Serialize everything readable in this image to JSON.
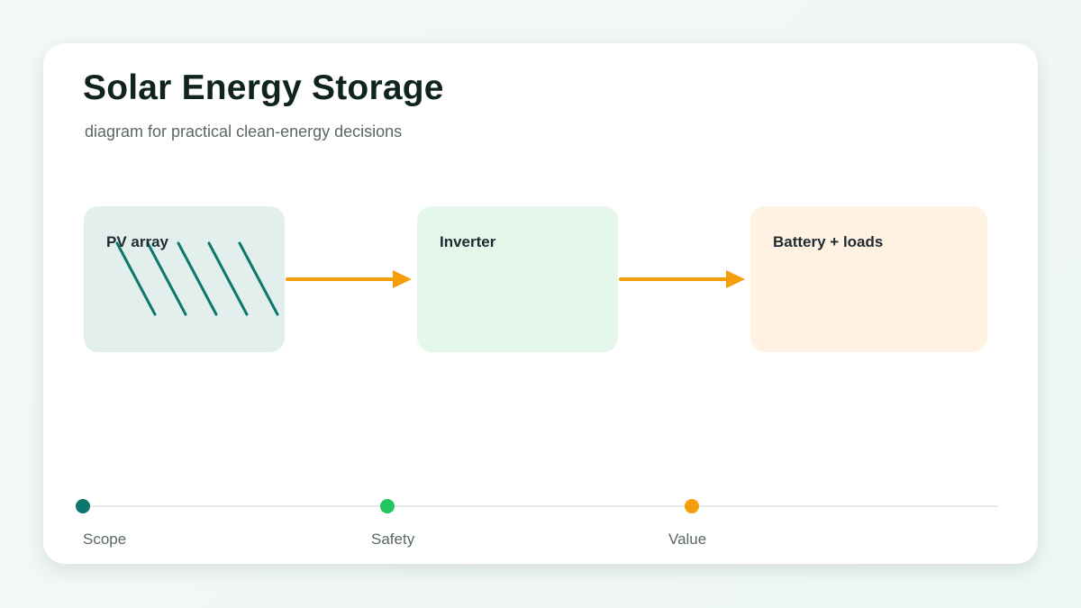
{
  "title": "Solar Energy Storage",
  "subtitle": "diagram for practical clean-energy decisions",
  "nodes": [
    {
      "id": "pv",
      "label": "PV array",
      "fill": "#e2efec"
    },
    {
      "id": "inverter",
      "label": "Inverter",
      "fill": "#e5f6ea"
    },
    {
      "id": "battery",
      "label": "Battery + loads",
      "fill": "#fff2e3"
    }
  ],
  "edges": [
    {
      "from": "pv",
      "to": "inverter"
    },
    {
      "from": "inverter",
      "to": "battery"
    }
  ],
  "timeline": [
    {
      "label": "Scope",
      "color": "#0f766e"
    },
    {
      "label": "Safety",
      "color": "#22c55e"
    },
    {
      "label": "Value",
      "color": "#f59e0b"
    }
  ],
  "colors": {
    "accent": "#f59e0b",
    "panel_stripe": "#0f766e",
    "track": "#e3ecea"
  }
}
